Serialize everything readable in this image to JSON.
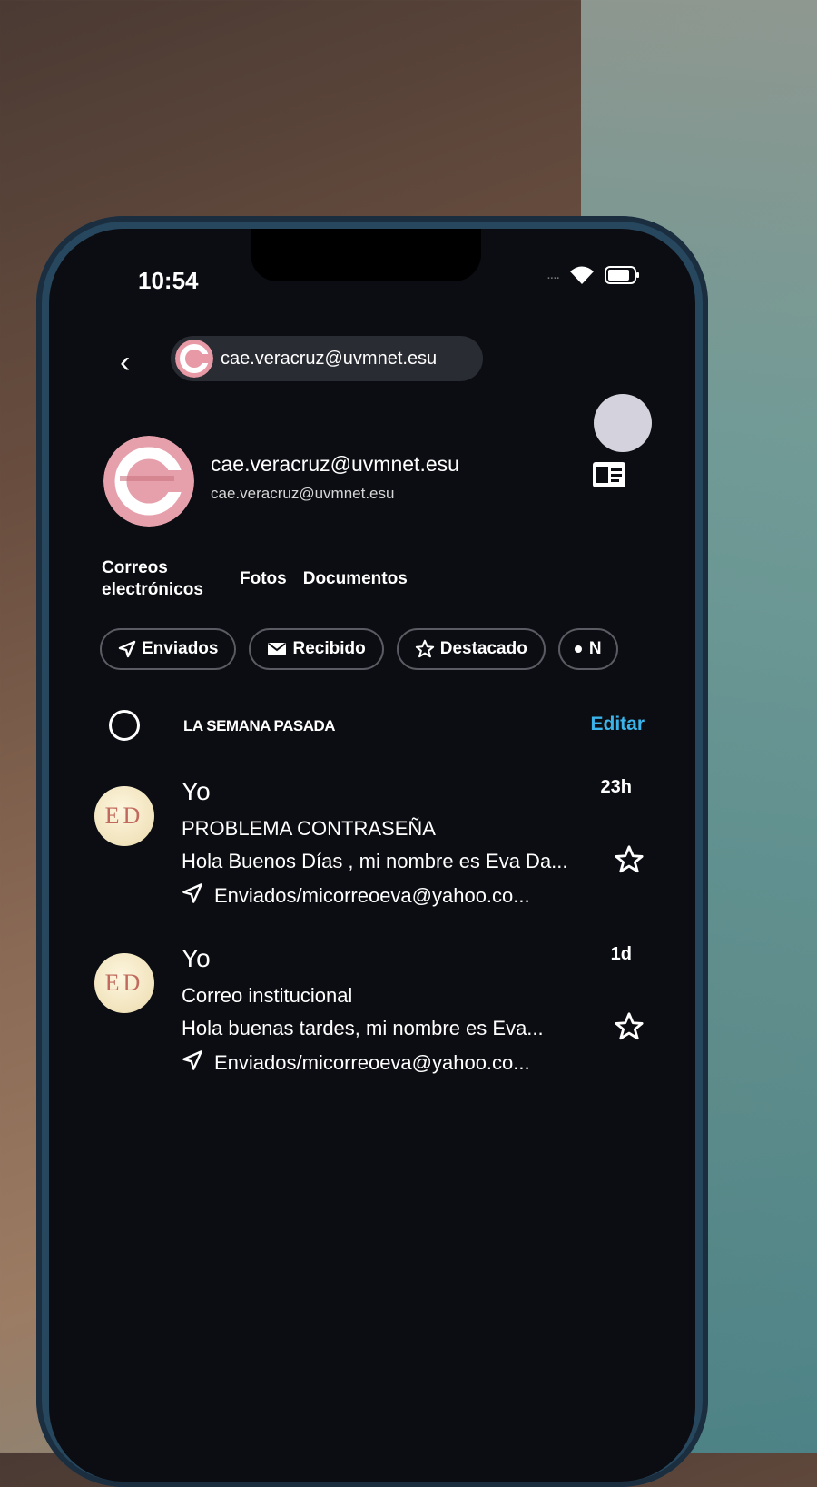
{
  "status_bar": {
    "time": "10:54",
    "signal": "...."
  },
  "header": {
    "account": "cae.veracruz@uvmnet.esu",
    "back_icon": "chevron-left-icon"
  },
  "profile": {
    "name": "cae.veracruz@uvmnet.esu",
    "email": "cae.veracruz@uvmnet.esu"
  },
  "tabs": [
    {
      "label": "Correos electrónicos"
    },
    {
      "label": "Fotos"
    },
    {
      "label": "Documentos"
    }
  ],
  "filters": [
    {
      "label": "Enviados",
      "icon": "send-icon"
    },
    {
      "label": "Recibido",
      "icon": "envelope-icon"
    },
    {
      "label": "Destacado",
      "icon": "star-icon"
    },
    {
      "label": "N",
      "icon": "dot-icon"
    }
  ],
  "section": {
    "label": "LA SEMANA PASADA",
    "edit": "Editar"
  },
  "emails": [
    {
      "initials": "ED",
      "from": "Yo",
      "ago": "23h",
      "subject": "PROBLEMA CONTRASEÑA",
      "preview": "Hola Buenos Días , mi nombre es Eva Da...",
      "folder": "Enviados/micorreoeva@yahoo.co..."
    },
    {
      "initials": "ED",
      "from": "Yo",
      "ago": "1d",
      "subject": "Correo institucional",
      "preview": "Hola buenas tardes, mi nombre es Eva...",
      "folder": "Enviados/micorreoeva@yahoo.co..."
    }
  ],
  "colors": {
    "accent": "#3ab4ea",
    "background": "#0c0d12",
    "chip_border": "#5a5b63"
  }
}
